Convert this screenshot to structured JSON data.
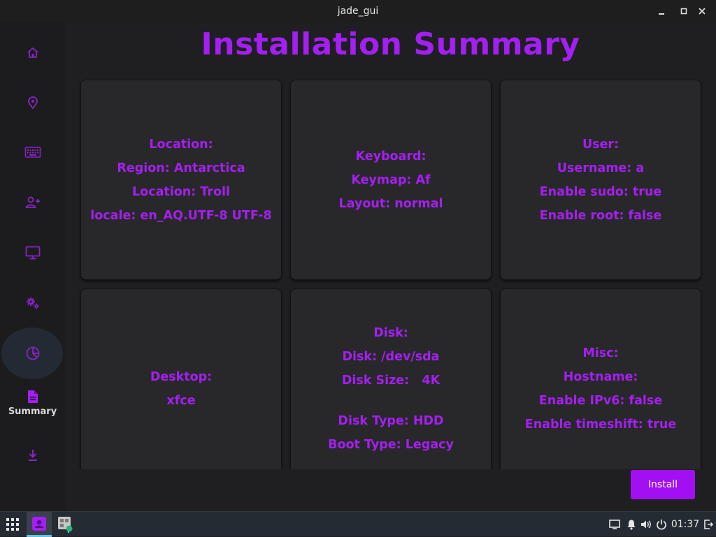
{
  "window": {
    "title": "jade_gui"
  },
  "sidebar": {
    "items": [
      {
        "icon": "home-icon",
        "label": ""
      },
      {
        "icon": "location-pin-icon",
        "label": ""
      },
      {
        "icon": "keyboard-icon",
        "label": ""
      },
      {
        "icon": "add-user-icon",
        "label": ""
      },
      {
        "icon": "monitor-icon",
        "label": ""
      },
      {
        "icon": "gears-icon",
        "label": ""
      },
      {
        "icon": "pie-chart-icon",
        "label": ""
      },
      {
        "icon": "document-icon",
        "label": "Summary"
      },
      {
        "icon": "download-icon",
        "label": ""
      }
    ]
  },
  "main": {
    "heading": "Installation Summary",
    "cards": {
      "location": [
        "Location:",
        "Region: Antarctica",
        "Location: Troll",
        "locale: en_AQ.UTF-8 UTF-8"
      ],
      "keyboard": [
        "Keyboard:",
        "Keymap: Af",
        "Layout: normal"
      ],
      "user": [
        "User:",
        "Username: a",
        "Enable sudo: true",
        "Enable root: false"
      ],
      "desktop": [
        "Desktop:",
        "xfce"
      ],
      "disk": [
        "Disk:",
        "Disk: /dev/sda",
        "Disk Size:   4K",
        "Disk Type: HDD",
        "Boot Type: Legacy"
      ],
      "misc": [
        "Misc:",
        "Hostname:",
        "Enable IPv6: false",
        "Enable timeshift: true"
      ]
    },
    "install_label": "Install"
  },
  "taskbar": {
    "clock": "01:37"
  },
  "colors": {
    "accent": "#a31ff2",
    "card_bg": "#28282a",
    "sidebar_bg": "#1c1c1e",
    "taskbar_bg": "#252b33"
  }
}
